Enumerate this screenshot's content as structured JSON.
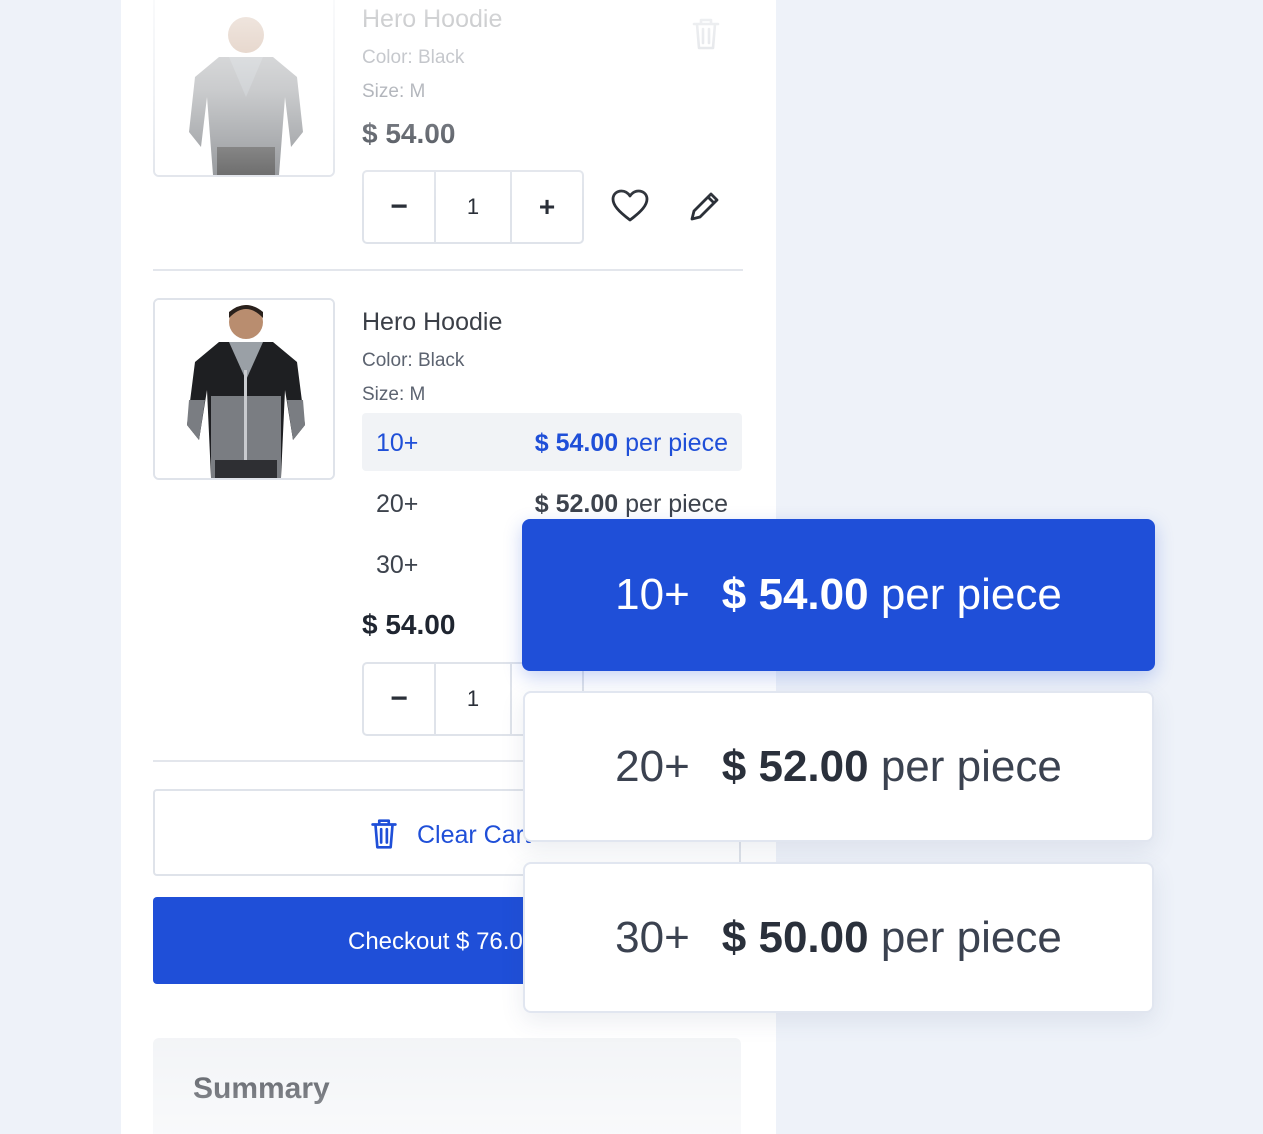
{
  "cart_items": [
    {
      "name": "Hero Hoodie",
      "color_label": "Color: Black",
      "size_label": "Size: M",
      "price": "$ 54.00",
      "quantity": "1",
      "minus": "−",
      "plus": "+"
    },
    {
      "name": "Hero Hoodie",
      "color_label": "Color: Black",
      "size_label": "Size: M",
      "price": "$ 54.00",
      "quantity": "1",
      "minus": "−",
      "tiers": [
        {
          "qty": "10+",
          "price": "$ 54.00",
          "unit": "per piece",
          "active": true
        },
        {
          "qty": "20+",
          "price": "$ 52.00",
          "unit": "per piece",
          "active": false
        },
        {
          "qty": "30+",
          "price": "",
          "unit": "",
          "active": false
        }
      ]
    }
  ],
  "actions": {
    "clear_cart_label": "Clear Cart",
    "checkout_label": "Checkout $ 76.00"
  },
  "summary": {
    "title": "Summary"
  },
  "tier_popup": [
    {
      "qty": "10+",
      "price": "$ 54.00",
      "unit": "per piece",
      "selected": true
    },
    {
      "qty": "20+",
      "price": "$ 52.00",
      "unit": "per piece",
      "selected": false
    },
    {
      "qty": "30+",
      "price": "$ 50.00",
      "unit": "per piece",
      "selected": false
    }
  ],
  "colors": {
    "accent": "#1f4fd8",
    "background": "#eef2f9",
    "panel": "#ffffff",
    "border": "#dfe3ea"
  },
  "icons": [
    "trash-icon",
    "heart-icon",
    "pencil-icon",
    "minus-icon",
    "plus-icon"
  ]
}
